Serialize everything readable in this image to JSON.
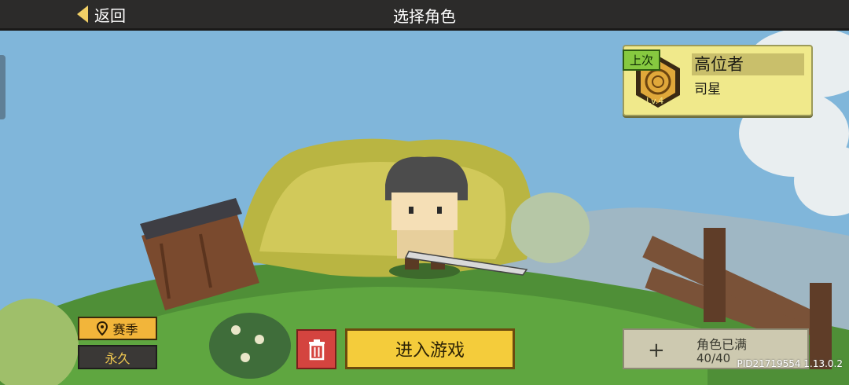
{
  "topbar": {
    "back_label": "返回",
    "title": "选择角色"
  },
  "last_character": {
    "badge": "上次",
    "name": "高位者",
    "class_name": "司星",
    "level_label": "Lv.4"
  },
  "season": {
    "label": "赛季",
    "mode": "永久"
  },
  "actions": {
    "enter_label": "进入游戏",
    "full_label": "角色已满",
    "full_count": "40/40"
  },
  "pid_text": "PID21719554 1.13.0.2",
  "colors": {
    "accent_yellow": "#f4cc3b",
    "delete_red": "#d4443f",
    "badge_green": "#86c940",
    "card_bg": "#f0e98b"
  }
}
